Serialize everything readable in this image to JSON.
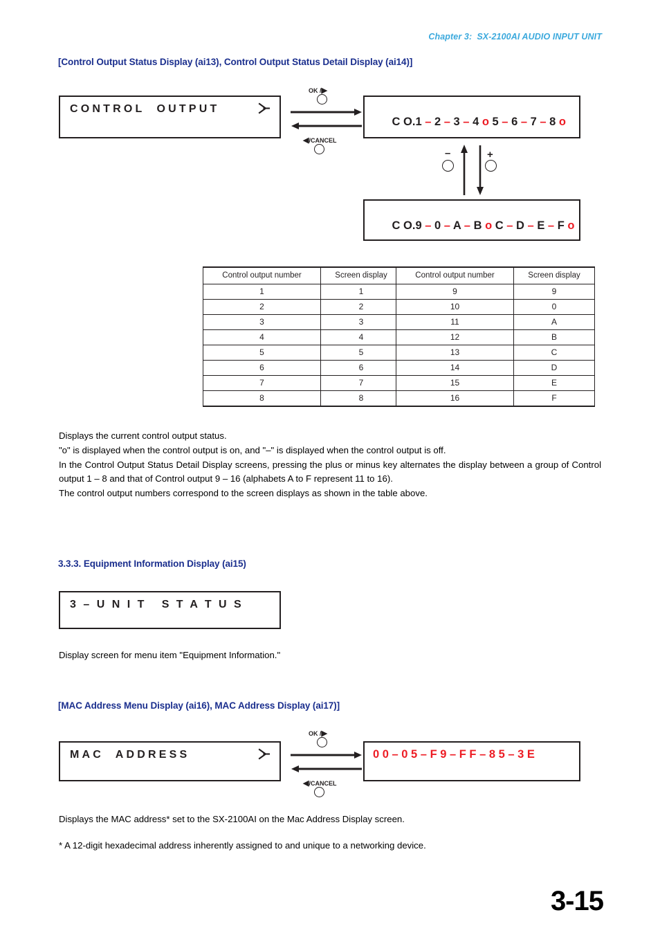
{
  "header": {
    "chapter": "Chapter 3:  SX-2100AI AUDIO INPUT UNIT"
  },
  "page_number": "3-15",
  "sections": {
    "control_output": {
      "heading": "[Control Output Status Display (ai13), Control Output Status Detail Display (ai14)]",
      "menu_display": {
        "text": "CONTROL  OUTPUT",
        "arrow_icon": "submenu-arrow-icon"
      },
      "transition": {
        "ok_label": "OK /",
        "ok_symbol": "▶",
        "cancel_symbol": "◀",
        "cancel_label": "/CANCEL"
      },
      "detail_display_1": {
        "prefix": "C O.",
        "tokens": [
          {
            "t": "1",
            "red": false
          },
          {
            "t": " – ",
            "red": true
          },
          {
            "t": "2",
            "red": false
          },
          {
            "t": " – ",
            "red": true
          },
          {
            "t": "3",
            "red": false
          },
          {
            "t": " – ",
            "red": true
          },
          {
            "t": "4",
            "red": false
          },
          {
            "t": " o ",
            "red": true
          },
          {
            "t": "5",
            "red": false
          },
          {
            "t": " – ",
            "red": true
          },
          {
            "t": "6",
            "red": false
          },
          {
            "t": " – ",
            "red": true
          },
          {
            "t": "7",
            "red": false
          },
          {
            "t": " – ",
            "red": true
          },
          {
            "t": "8",
            "red": false
          },
          {
            "t": " o",
            "red": true
          }
        ]
      },
      "detail_display_2": {
        "prefix": "C O.",
        "tokens": [
          {
            "t": "9",
            "red": false
          },
          {
            "t": " – ",
            "red": true
          },
          {
            "t": "0",
            "red": false
          },
          {
            "t": " – ",
            "red": true
          },
          {
            "t": "A",
            "red": false
          },
          {
            "t": " – ",
            "red": true
          },
          {
            "t": "B",
            "red": false
          },
          {
            "t": " o ",
            "red": true
          },
          {
            "t": "C",
            "red": false
          },
          {
            "t": " – ",
            "red": true
          },
          {
            "t": "D",
            "red": false
          },
          {
            "t": " – ",
            "red": true
          },
          {
            "t": "E",
            "red": false
          },
          {
            "t": " – ",
            "red": true
          },
          {
            "t": "F",
            "red": false
          },
          {
            "t": " o",
            "red": true
          }
        ]
      },
      "plus_minus": {
        "minus_label": "–",
        "plus_label": "+"
      },
      "table_left": {
        "headers": [
          "Control output number",
          "Screen display"
        ],
        "rows": [
          [
            "1",
            "1"
          ],
          [
            "2",
            "2"
          ],
          [
            "3",
            "3"
          ],
          [
            "4",
            "4"
          ],
          [
            "5",
            "5"
          ],
          [
            "6",
            "6"
          ],
          [
            "7",
            "7"
          ],
          [
            "8",
            "8"
          ]
        ]
      },
      "table_right": {
        "headers": [
          "Control output number",
          "Screen display"
        ],
        "rows": [
          [
            "9",
            "9"
          ],
          [
            "10",
            "0"
          ],
          [
            "11",
            "A"
          ],
          [
            "12",
            "B"
          ],
          [
            "13",
            "C"
          ],
          [
            "14",
            "D"
          ],
          [
            "15",
            "E"
          ],
          [
            "16",
            "F"
          ]
        ]
      },
      "paragraph": "Displays the current control output status.\n\"o\" is displayed when the control output is on, and \"–\" is displayed when the control output is off.\nIn the Control Output Status Detail Display screens, pressing the plus or minus key alternates the display between a group of Control output 1 – 8 and that of Control output 9 – 16 (alphabets A to F represent 11 to 16).\nThe control output numbers correspond to the screen displays as shown in the table above."
    },
    "equipment_info": {
      "heading": "3.3.3. Equipment Information Display (ai15)",
      "display": {
        "text": "3 – U N I T   S T A T U S"
      },
      "paragraph": "Display screen for menu item \"Equipment Information.\""
    },
    "mac_address": {
      "heading": "[MAC Address Menu Display (ai16), MAC Address Display (ai17)]",
      "menu_display": {
        "text": "MAC  ADDRESS",
        "arrow_icon": "submenu-arrow-icon"
      },
      "transition": {
        "ok_label": "OK /",
        "ok_symbol": "▶",
        "cancel_symbol": "◀",
        "cancel_label": "/CANCEL"
      },
      "value_display": {
        "value": "0 0 – 0 5 – F 9 – F F – 8 5 – 3 E"
      },
      "paragraph": "Displays the MAC address* set to the SX-2100AI on the Mac Address Display screen.",
      "footnote": "* A 12-digit hexadecimal address inherently assigned to and unique to a networking device."
    }
  },
  "colors": {
    "heading_blue": "#1b2f8e",
    "header_light_blue": "#3ba9dd",
    "accent_red": "#ed1c24",
    "ink": "#231f20"
  }
}
